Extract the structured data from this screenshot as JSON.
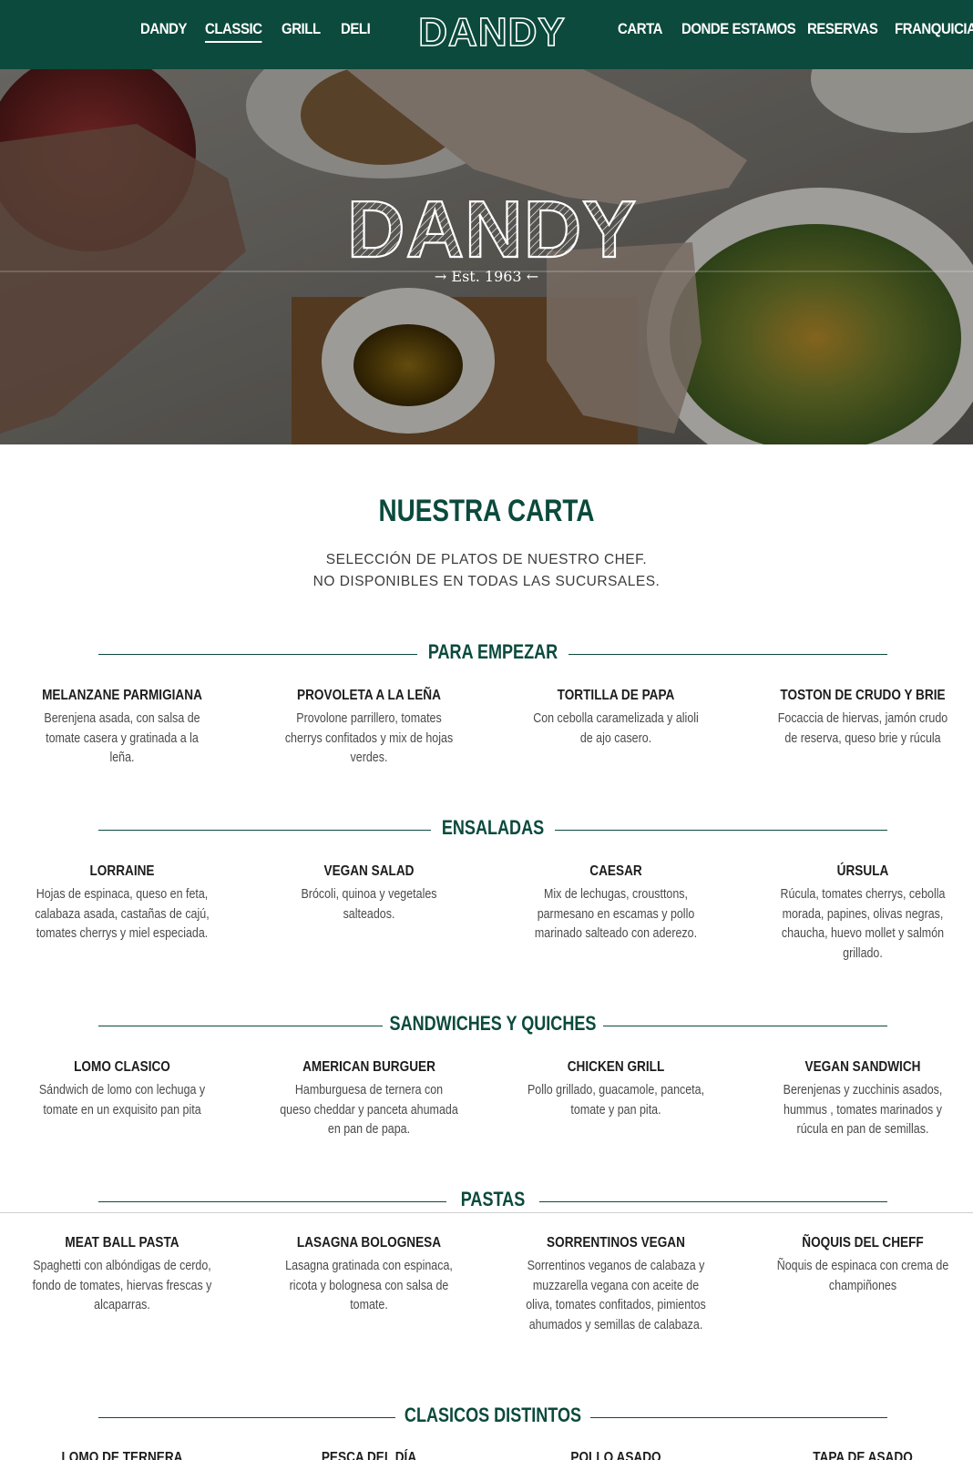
{
  "nav": {
    "left": [
      "DANDY",
      "CLASSIC",
      "GRILL",
      "DELI"
    ],
    "active": "CLASSIC",
    "logo": "DANDY",
    "right": [
      "CARTA",
      "DONDE ESTAMOS",
      "RESERVAS",
      "FRANQUICIAS"
    ]
  },
  "hero": {
    "logo": "DANDY",
    "est": "Est. 1963"
  },
  "menu": {
    "title": "NUESTRA CARTA",
    "subtitle_line1": "SELECCIÓN DE PLATOS DE NUESTRO CHEF.",
    "subtitle_line2": "NO DISPONIBLES EN TODAS LAS SUCURSALES.",
    "sections": [
      {
        "title": "PARA EMPEZAR",
        "items": [
          {
            "name": "MELANZANE PARMIGIANA",
            "desc": "Berenjena asada, con salsa de tomate casera y gratinada a la leña."
          },
          {
            "name": "PROVOLETA A LA LEÑA",
            "desc": "Provolone parrillero, tomates cherrys confitados y mix de hojas verdes."
          },
          {
            "name": "TORTILLA DE PAPA",
            "desc": "Con cebolla caramelizada y alioli de ajo casero."
          },
          {
            "name": "TOSTON DE CRUDO Y BRIE",
            "desc": "Focaccia de hiervas, jamón crudo de reserva, queso brie y rúcula"
          }
        ]
      },
      {
        "title": "ENSALADAS",
        "items": [
          {
            "name": "LORRAINE",
            "desc": "Hojas de espinaca, queso en feta, calabaza asada, castañas de cajú, tomates cherrys y miel especiada."
          },
          {
            "name": "VEGAN SALAD",
            "desc": "Brócoli, quinoa y vegetales salteados."
          },
          {
            "name": "CAESAR",
            "desc": "Mix de lechugas, crousttons, parmesano en escamas y pollo marinado salteado con aderezo."
          },
          {
            "name": "ÚRSULA",
            "desc": "Rúcula, tomates cherrys, cebolla morada, papines, olivas negras, chaucha, huevo mollet y salmón grillado."
          }
        ]
      },
      {
        "title": "SANDWICHES Y QUICHES",
        "items": [
          {
            "name": "LOMO CLASICO",
            "desc": "Sándwich de lomo con lechuga y tomate en un exquisito pan pita"
          },
          {
            "name": "AMERICAN BURGUER",
            "desc": "Hamburguesa de ternera con queso cheddar y panceta ahumada en pan de papa."
          },
          {
            "name": "CHICKEN GRILL",
            "desc": "Pollo grillado, guacamole, panceta, tomate y pan pita."
          },
          {
            "name": "VEGAN SANDWICH",
            "desc": "Berenjenas y zucchinis asados, hummus , tomates marinados y rúcula en pan de semillas."
          }
        ]
      },
      {
        "title": "PASTAS",
        "items": [
          {
            "name": "MEAT BALL PASTA",
            "desc": "Spaghetti con albóndigas de cerdo, fondo de tomates, hiervas frescas y alcaparras."
          },
          {
            "name": "LASAGNA BOLOGNESA",
            "desc": "Lasagna gratinada con espinaca, ricota y bolognesa con salsa de tomate."
          },
          {
            "name": "SORRENTINOS VEGAN",
            "desc": "Sorrentinos veganos de calabaza y muzzarella vegana con aceite de oliva, tomates confitados, pimientos ahumados y semillas de calabaza."
          },
          {
            "name": "ÑOQUIS DEL CHEFF",
            "desc": "Ñoquis de espinaca con crema de champiñones"
          }
        ]
      },
      {
        "title": "CLASICOS DISTINTOS",
        "items": [
          {
            "name": "LOMO DE TERNERA",
            "desc": ""
          },
          {
            "name": "PESCA DEL DÍA",
            "desc": ""
          },
          {
            "name": "POLLO ASADO",
            "desc": ""
          },
          {
            "name": "TAPA DE ASADO",
            "desc": ""
          }
        ]
      }
    ]
  },
  "colors": {
    "brand_green": "#0b4a3c",
    "text_dark": "#1c1c1c",
    "text_body": "#4a4a4a"
  }
}
